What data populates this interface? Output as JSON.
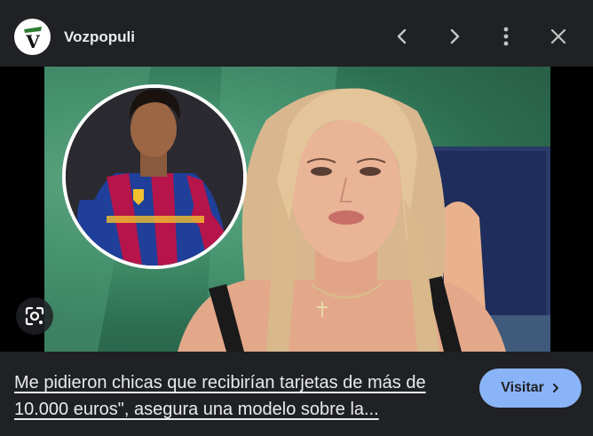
{
  "header": {
    "source_logo_letter": "V",
    "source_name": "Vozpopuli"
  },
  "image": {
    "alt": ""
  },
  "footer": {
    "title": "Me pidieron chicas que recibirían tarjetas de más de 10.000 euros\", asegura una modelo sobre la...",
    "visit_label": "Visitar"
  },
  "colors": {
    "background": "#202124",
    "text": "#e8eaed",
    "accent": "#8ab4f8",
    "logo_green": "#2e7d32"
  },
  "icons": [
    "chevron-left-icon",
    "chevron-right-icon",
    "more-vert-icon",
    "close-icon",
    "lens-icon",
    "chevron-right-small-icon"
  ]
}
